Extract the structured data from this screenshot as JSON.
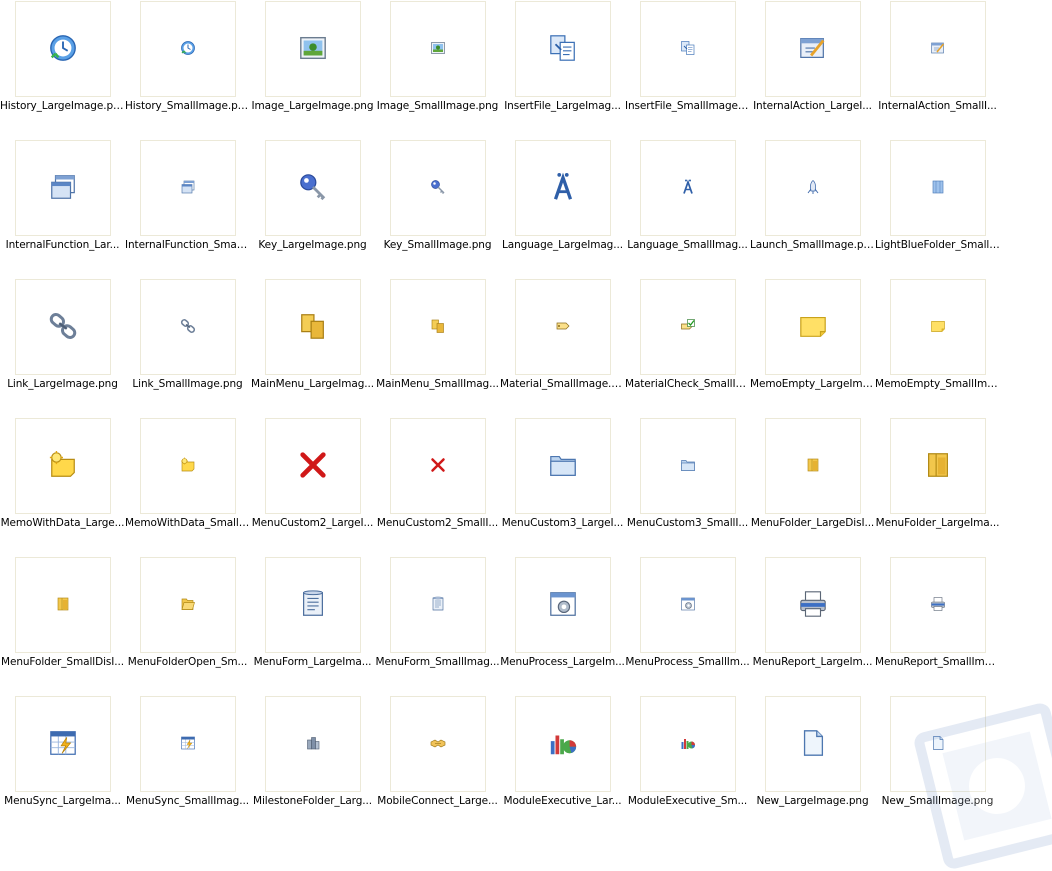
{
  "files": [
    {
      "label": "History_LargeImage.png",
      "icon": "history-icon",
      "size": "large"
    },
    {
      "label": "History_SmallImage.png",
      "icon": "history-icon",
      "size": "small"
    },
    {
      "label": "Image_LargeImage.png",
      "icon": "image-icon",
      "size": "large"
    },
    {
      "label": "Image_SmallImage.png",
      "icon": "image-icon",
      "size": "small"
    },
    {
      "label": "InsertFile_LargeImag...",
      "icon": "insert-file-icon",
      "size": "large"
    },
    {
      "label": "InsertFile_SmallImage....",
      "icon": "insert-file-icon",
      "size": "small"
    },
    {
      "label": "InternalAction_LargeI...",
      "icon": "internal-action-icon",
      "size": "large"
    },
    {
      "label": "InternalAction_SmallI...",
      "icon": "internal-action-icon",
      "size": "small"
    },
    {
      "label": "InternalFunction_Lar...",
      "icon": "internal-function-icon",
      "size": "large"
    },
    {
      "label": "InternalFunction_Small...",
      "icon": "internal-function-icon",
      "size": "small"
    },
    {
      "label": "Key_LargeImage.png",
      "icon": "key-icon",
      "size": "large"
    },
    {
      "label": "Key_SmallImage.png",
      "icon": "key-icon",
      "size": "small"
    },
    {
      "label": "Language_LargeImag...",
      "icon": "language-icon",
      "size": "large"
    },
    {
      "label": "Language_SmallImag...",
      "icon": "language-icon",
      "size": "small"
    },
    {
      "label": "Launch_SmallImage.png",
      "icon": "launch-icon",
      "size": "small"
    },
    {
      "label": "LightBlueFolder_SmallI...",
      "icon": "lightblue-folder-icon",
      "size": "small"
    },
    {
      "label": "Link_LargeImage.png",
      "icon": "link-icon",
      "size": "large"
    },
    {
      "label": "Link_SmallImage.png",
      "icon": "link-icon",
      "size": "small"
    },
    {
      "label": "MainMenu_LargeImag...",
      "icon": "main-menu-icon",
      "size": "large"
    },
    {
      "label": "MainMenu_SmallImag...",
      "icon": "main-menu-icon",
      "size": "small"
    },
    {
      "label": "Material_SmallImage.png",
      "icon": "material-tag-icon",
      "size": "small"
    },
    {
      "label": "MaterialCheck_SmallIm...",
      "icon": "material-check-icon",
      "size": "small"
    },
    {
      "label": "MemoEmpty_LargeIma...",
      "icon": "memo-empty-icon",
      "size": "large"
    },
    {
      "label": "MemoEmpty_SmallIma...",
      "icon": "memo-empty-icon",
      "size": "small"
    },
    {
      "label": "MemoWithData_Large...",
      "icon": "memo-with-data-icon",
      "size": "large"
    },
    {
      "label": "MemoWithData_SmallI...",
      "icon": "memo-with-data-icon",
      "size": "small"
    },
    {
      "label": "MenuCustom2_LargeI...",
      "icon": "red-x-icon",
      "size": "large"
    },
    {
      "label": "MenuCustom2_SmallI...",
      "icon": "red-x-icon",
      "size": "small"
    },
    {
      "label": "MenuCustom3_LargeI...",
      "icon": "blue-folder-icon",
      "size": "large"
    },
    {
      "label": "MenuCustom3_SmallI...",
      "icon": "blue-folder-icon",
      "size": "small"
    },
    {
      "label": "MenuFolder_LargeDisI...",
      "icon": "menu-folder-icon",
      "size": "small"
    },
    {
      "label": "MenuFolder_LargeIma...",
      "icon": "menu-folder-icon",
      "size": "large"
    },
    {
      "label": "MenuFolder_SmallDisI...",
      "icon": "menu-folder-icon",
      "size": "small"
    },
    {
      "label": "MenuFolderOpen_Sm...",
      "icon": "menu-folder-open-icon",
      "size": "small"
    },
    {
      "label": "MenuForm_LargeIma...",
      "icon": "menu-form-icon",
      "size": "large"
    },
    {
      "label": "MenuForm_SmallImag...",
      "icon": "menu-form-icon",
      "size": "small"
    },
    {
      "label": "MenuProcess_LargeIm...",
      "icon": "menu-process-icon",
      "size": "large"
    },
    {
      "label": "MenuProcess_SmallIm...",
      "icon": "menu-process-icon",
      "size": "small"
    },
    {
      "label": "MenuReport_LargeIm...",
      "icon": "printer-icon",
      "size": "large"
    },
    {
      "label": "MenuReport_SmallIma...",
      "icon": "printer-icon",
      "size": "small"
    },
    {
      "label": "MenuSync_LargeIma...",
      "icon": "menu-sync-icon",
      "size": "large"
    },
    {
      "label": "MenuSync_SmallImag...",
      "icon": "menu-sync-icon",
      "size": "small"
    },
    {
      "label": "MilestoneFolder_Larg...",
      "icon": "milestone-folder-icon",
      "size": "small"
    },
    {
      "label": "MobileConnect_Large...",
      "icon": "mobile-connect-icon",
      "size": "small"
    },
    {
      "label": "ModuleExecutive_Lar...",
      "icon": "module-executive-icon",
      "size": "large"
    },
    {
      "label": "ModuleExecutive_Sm...",
      "icon": "module-executive-icon",
      "size": "small"
    },
    {
      "label": "New_LargeImage.png",
      "icon": "new-file-icon",
      "size": "large"
    },
    {
      "label": "New_SmallImage.png",
      "icon": "new-file-icon",
      "size": "small"
    }
  ]
}
